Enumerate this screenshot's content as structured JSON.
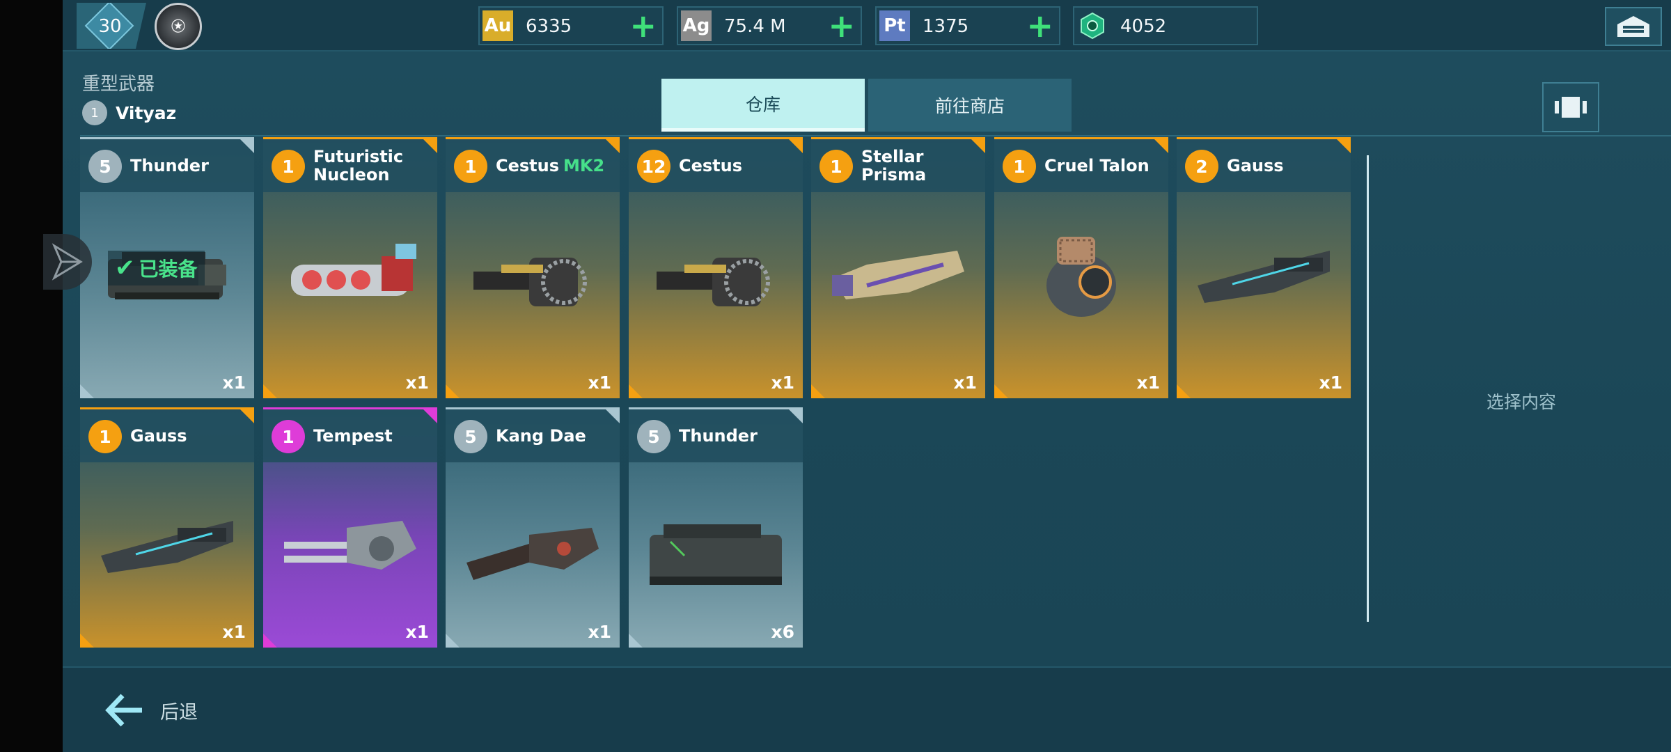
{
  "topbar": {
    "player_level": "30",
    "currencies": [
      {
        "code": "Au",
        "value": "6335",
        "color": "#d9ad2a",
        "has_plus": true
      },
      {
        "code": "Ag",
        "value": "75.4 M",
        "color": "#8c8c8c",
        "has_plus": true
      },
      {
        "code": "Pt",
        "value": "1375",
        "color": "#5e7bc0",
        "has_plus": true
      },
      {
        "code": "",
        "value": "4052",
        "color": "#1fb37f",
        "has_plus": false
      }
    ]
  },
  "header": {
    "category": "重型武器",
    "robot_level": "1",
    "robot_name": "Vityaz"
  },
  "tabs": [
    {
      "label": "仓库",
      "active": true
    },
    {
      "label": "前往商店",
      "active": false
    }
  ],
  "weapons": [
    {
      "level": "5",
      "name": "Thunder",
      "name_suffix": "",
      "qty": "x1",
      "rarity": "common",
      "equipped_label": "已装备"
    },
    {
      "level": "1",
      "name": "Futuristic Nucleon",
      "name_suffix": "",
      "qty": "x1",
      "rarity": "epic"
    },
    {
      "level": "1",
      "name": "Cestus",
      "name_suffix": "MK2",
      "qty": "x1",
      "rarity": "epic"
    },
    {
      "level": "12",
      "name": "Cestus",
      "name_suffix": "",
      "qty": "x1",
      "rarity": "epic"
    },
    {
      "level": "1",
      "name": "Stellar Prisma",
      "name_suffix": "",
      "qty": "x1",
      "rarity": "epic"
    },
    {
      "level": "1",
      "name": "Cruel Talon",
      "name_suffix": "",
      "qty": "x1",
      "rarity": "epic"
    },
    {
      "level": "2",
      "name": "Gauss",
      "name_suffix": "",
      "qty": "x1",
      "rarity": "epic"
    },
    {
      "level": "1",
      "name": "Gauss",
      "name_suffix": "",
      "qty": "x1",
      "rarity": "epic"
    },
    {
      "level": "1",
      "name": "Tempest",
      "name_suffix": "",
      "qty": "x1",
      "rarity": "legendary"
    },
    {
      "level": "5",
      "name": "Kang Dae",
      "name_suffix": "",
      "qty": "x1",
      "rarity": "common"
    },
    {
      "level": "5",
      "name": "Thunder",
      "name_suffix": "",
      "qty": "x6",
      "rarity": "common"
    }
  ],
  "rarity_colors": {
    "common": {
      "badge": "#9fb3bc",
      "accent": "#a9c6d1"
    },
    "epic": {
      "badge": "#f5a011",
      "accent": "#f5a011"
    },
    "legendary": {
      "badge": "#de3cd8",
      "accent": "#de3cd8"
    }
  },
  "right_panel": {
    "placeholder": "选择内容"
  },
  "footer": {
    "back_label": "后退"
  }
}
